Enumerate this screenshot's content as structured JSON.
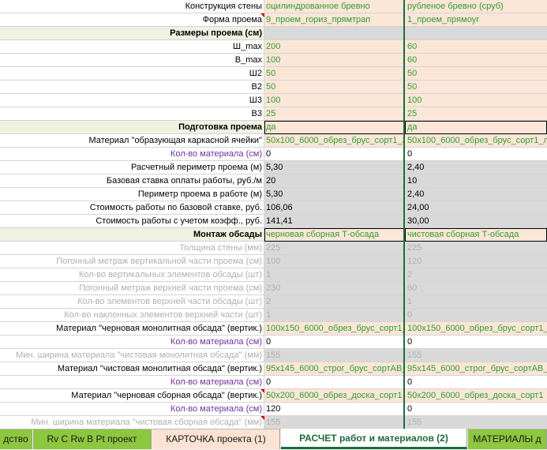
{
  "rows": [
    {
      "label": "Конструкция стены",
      "c1": "оцилиндрованное бревно",
      "c2": "рубленое бревно (сруб)",
      "labelStyle": "black",
      "valStyle": "green",
      "bg": "bg-peach"
    },
    {
      "label": "Форма проема",
      "c1": "9_проем_гориз_прямтрап",
      "c2": "1_проем_прямоуг",
      "labelStyle": "black",
      "valStyle": "green",
      "bg": "bg-peach"
    },
    {
      "label": "Размеры проема (см)",
      "c1": "",
      "c2": "",
      "labelStyle": "section",
      "valStyle": "green",
      "bg": "bg-gray"
    },
    {
      "label": "Ш_max",
      "c1": "200",
      "c2": "60",
      "labelStyle": "black",
      "valStyle": "green",
      "bg": "bg-peach"
    },
    {
      "label": "В_max",
      "c1": "100",
      "c2": "60",
      "labelStyle": "black",
      "valStyle": "green",
      "bg": "bg-peach"
    },
    {
      "label": "Ш2",
      "c1": "50",
      "c2": "50",
      "labelStyle": "black",
      "valStyle": "green",
      "bg": "bg-peach"
    },
    {
      "label": "В2",
      "c1": "50",
      "c2": "50",
      "labelStyle": "black",
      "valStyle": "green",
      "bg": "bg-peach"
    },
    {
      "label": "Ш3",
      "c1": "100",
      "c2": "100",
      "labelStyle": "black",
      "valStyle": "green",
      "bg": "bg-peach"
    },
    {
      "label": "В3",
      "c1": "25",
      "c2": "25",
      "labelStyle": "black",
      "valStyle": "green",
      "bg": "bg-peach"
    },
    {
      "label": "Подготовка проема",
      "c1": "да",
      "c2": "да",
      "labelStyle": "section",
      "valStyle": "green",
      "bg": "bg-peach",
      "boxed": true
    },
    {
      "label": "Материал \"образующая каркасной ячейки\"",
      "c1": "50х100_6000_обрез_брус_сорт1_л",
      "c2": "50х100_6000_обрез_брус_сорт1_л",
      "labelStyle": "black",
      "valStyle": "green",
      "bg": "bg-peach"
    },
    {
      "label": "Кол-во материала (см)",
      "c1": "0",
      "c2": "0",
      "labelStyle": "purple",
      "valStyle": "black",
      "bg": "bg-white"
    },
    {
      "label": "Расчетный периметр проема (м)",
      "c1": "5,30",
      "c2": "2,40",
      "labelStyle": "black",
      "valStyle": "black",
      "bg": "bg-gray"
    },
    {
      "label": "Базовая ставка оплаты работы, руб./м",
      "c1": "20",
      "c2": "10",
      "labelStyle": "black",
      "valStyle": "black",
      "bg": "bg-gray"
    },
    {
      "label": "Периметр проема в работе (м)",
      "c1": "5,30",
      "c2": "2,40",
      "labelStyle": "black",
      "valStyle": "black",
      "bg": "bg-gray"
    },
    {
      "label": "Стоимость работы по базовой ставке, руб.",
      "c1": "106,06",
      "c2": "24,00",
      "labelStyle": "black",
      "valStyle": "black",
      "bg": "bg-gray"
    },
    {
      "label": "Стоимость работы с учетом коэфф., руб.",
      "c1": "141,41",
      "c2": "30,00",
      "labelStyle": "black",
      "valStyle": "black",
      "bg": "bg-gray"
    },
    {
      "label": "Монтаж обсады",
      "c1": "черновая сборная Т-обсада",
      "c2": "чистовая сборная Т-обсада",
      "labelStyle": "section",
      "valStyle": "green",
      "bg": "bg-peach",
      "boxed": true
    },
    {
      "label": "Толщина стены (мм)",
      "c1": "225",
      "c2": "225",
      "labelStyle": "gray",
      "valStyle": "gray",
      "bg": "bg-gray"
    },
    {
      "label": "Погонный метраж вертикальной части проема (см)",
      "c1": "100",
      "c2": "120",
      "labelStyle": "gray",
      "valStyle": "gray",
      "bg": "bg-gray"
    },
    {
      "label": "Кол-во вертикальных элементов обсады (шт)",
      "c1": "1",
      "c2": "2",
      "labelStyle": "gray",
      "valStyle": "gray",
      "bg": "bg-gray"
    },
    {
      "label": "Погонный метраж верхней части проема (см)",
      "c1": "230",
      "c2": "60",
      "labelStyle": "gray",
      "valStyle": "gray",
      "bg": "bg-gray"
    },
    {
      "label": "Кол-во элементов верхней части обсады (шт)",
      "c1": "2",
      "c2": "1",
      "labelStyle": "gray",
      "valStyle": "gray",
      "bg": "bg-gray"
    },
    {
      "label": "Кол-во наклонных элементов верхней части (шт)",
      "c1": "1",
      "c2": "0",
      "labelStyle": "gray",
      "valStyle": "gray",
      "bg": "bg-gray"
    },
    {
      "label": "Материал \"черновая монолитная обсада\" (вертик.)",
      "c1": "100х150_6000_обрез_брус_сорт1_",
      "c2": "100х150_6000_обрез_брус_сорт1_",
      "labelStyle": "black",
      "valStyle": "green",
      "bg": "bg-peach"
    },
    {
      "label": "Кол-во материала (см)",
      "c1": "0",
      "c2": "0",
      "labelStyle": "purple",
      "valStyle": "black",
      "bg": "bg-white"
    },
    {
      "label": "Мин. ширина материала \"чистовая монолитная обсада\" (мм)",
      "c1": "155",
      "c2": "155",
      "labelStyle": "gray",
      "valStyle": "gray",
      "bg": "bg-gray"
    },
    {
      "label": "Материал \"чистовая монолитная обсада\" (вертик.)",
      "c1": "95х145_6000_строг_брус_сортАВ_",
      "c2": "95х145_6000_строг_брус_сортАВ_",
      "labelStyle": "black",
      "valStyle": "green",
      "bg": "bg-peach"
    },
    {
      "label": "Кол-во материала (см)",
      "c1": "0",
      "c2": "0",
      "labelStyle": "purple",
      "valStyle": "black",
      "bg": "bg-white"
    },
    {
      "label": "Материал \"черновая сборная обсада\" (вертик.)",
      "c1": "50х200_6000_обрез_доска_сорт1",
      "c2": "50х200_6000_обрез_доска_сорт1",
      "labelStyle": "black",
      "valStyle": "green",
      "bg": "bg-peach"
    },
    {
      "label": "Кол-во материала (см)",
      "c1": "120",
      "c2": "0",
      "labelStyle": "purple",
      "valStyle": "black",
      "bg": "bg-white"
    },
    {
      "label": "Мин. ширина материала \"чистовая сборная обсада\" (мм)",
      "c1": "155",
      "c2": "155",
      "labelStyle": "gray",
      "valStyle": "gray",
      "bg": "bg-gray"
    }
  ],
  "tabs": [
    {
      "label": "дство",
      "style": "tab-green"
    },
    {
      "label": "Rv C Rw B Pt проект",
      "style": "tab-green"
    },
    {
      "label": "КАРТОЧКА проекта (1)",
      "style": "tab-peach"
    },
    {
      "label": "РАСЧЕТ работ и материалов (2)",
      "style": "tab-active"
    },
    {
      "label": "МАТЕРИАЛЫ д",
      "style": "tab-green"
    }
  ],
  "colors": {
    "accent": "#1e6b3a",
    "value_green": "#2e9e2e",
    "input_peach": "#fbe6d8",
    "calc_gray": "#d9d9d9",
    "section_bg": "#eef2e0",
    "purple": "#7030a0"
  }
}
